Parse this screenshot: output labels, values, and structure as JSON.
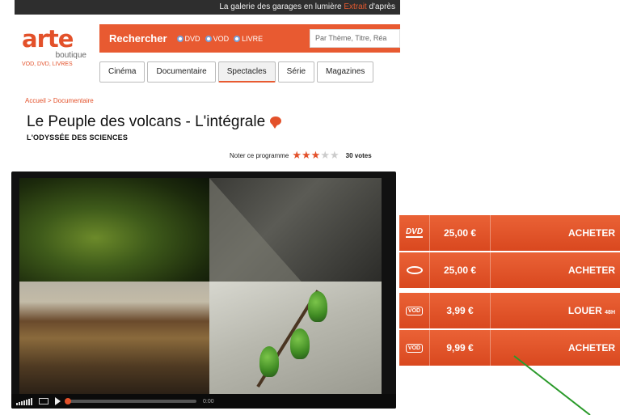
{
  "top_strip": {
    "text": "La galerie des garages en lumière",
    "highlight": "Extrait",
    "suffix": "d'après"
  },
  "logo": {
    "word": "arte",
    "sub1": "boutique",
    "sub2": "VOD, DVD, LIVRES"
  },
  "search": {
    "label": "Rechercher",
    "options": [
      "DVD",
      "VOD",
      "LIVRE"
    ],
    "placeholder": "Par Thème, Titre, Réa"
  },
  "tabs": [
    "Cinéma",
    "Documentaire",
    "Spectacles",
    "Série",
    "Magazines"
  ],
  "breadcrumb": "Accueil > Documentaire",
  "program": {
    "title": "Le Peuple des volcans - L'intégrale",
    "subtitle": "L'ODYSSÉE DES SCIENCES"
  },
  "rating": {
    "label": "Noter ce programme",
    "stars_filled": 3,
    "stars_total": 5,
    "votes": "30 votes"
  },
  "player": {
    "time": "0:00"
  },
  "offers": [
    {
      "icon": "dvd-icon",
      "icon_text": "DVD",
      "price": "25,00 €",
      "action": "ACHETER",
      "action_note": ""
    },
    {
      "icon": "bluray-icon",
      "icon_text": "",
      "price": "25,00 €",
      "action": "ACHETER",
      "action_note": ""
    },
    {
      "icon": "vod-rent-icon",
      "icon_text": "VOD",
      "price": "3,99 €",
      "action": "LOUER",
      "action_note": "48H"
    },
    {
      "icon": "vod-buy-icon",
      "icon_text": "VOD",
      "price": "9,99 €",
      "action": "ACHETER",
      "action_note": ""
    }
  ],
  "colors": {
    "accent": "#e85a31",
    "dark": "#2e2e2e",
    "pointer": "#2a9a2a"
  }
}
